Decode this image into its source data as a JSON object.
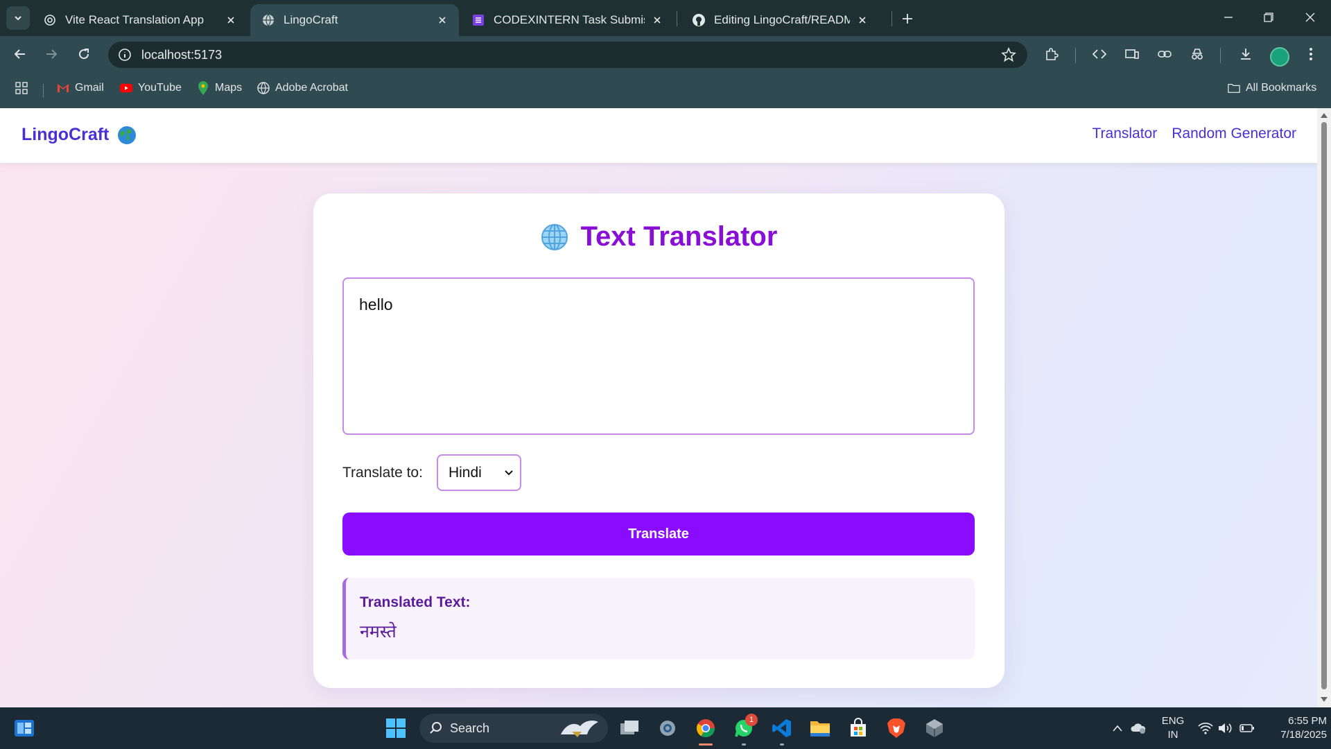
{
  "browser": {
    "tabs": [
      {
        "title": "Vite React Translation App",
        "active": false
      },
      {
        "title": "LingoCraft",
        "active": true
      },
      {
        "title": "CODEXINTERN Task Submission",
        "active": false
      },
      {
        "title": "Editing LingoCraft/README.md",
        "active": false
      }
    ],
    "url": "localhost:5173",
    "bookmarks": [
      "Gmail",
      "YouTube",
      "Maps",
      "Adobe Acrobat"
    ],
    "all_bookmarks": "All Bookmarks"
  },
  "app": {
    "brand": "LingoCraft",
    "nav": [
      "Translator",
      "Random Generator"
    ],
    "card_title": "Text Translator",
    "input_text": "hello",
    "translate_to_label": "Translate to:",
    "selected_language": "Hindi",
    "translate_button": "Translate",
    "result_label": "Translated Text:",
    "result_text": "नमस्ते",
    "accent_color": "#8a0cff",
    "brand_color": "#4b2fd6"
  },
  "taskbar": {
    "search_label": "Search",
    "whatsapp_badge": "1",
    "lang_line1": "ENG",
    "lang_line2": "IN",
    "time": "6:55 PM",
    "date": "7/18/2025"
  }
}
